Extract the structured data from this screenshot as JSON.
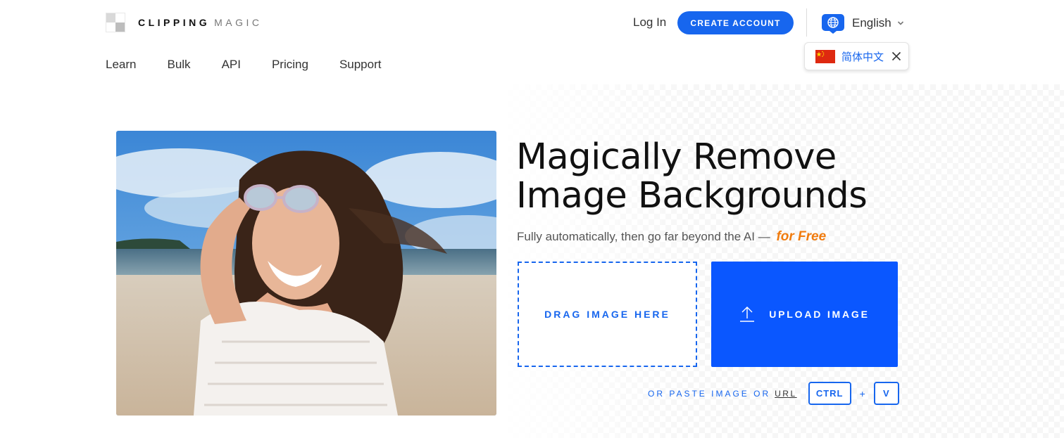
{
  "brand": {
    "name_bold": "CLIPPING",
    "name_light": "MAGIC"
  },
  "nav": {
    "items": [
      "Learn",
      "Bulk",
      "API",
      "Pricing",
      "Support"
    ]
  },
  "header": {
    "login_label": "Log In",
    "create_account_label": "CREATE ACCOUNT",
    "language_label": "English",
    "language_suggestion": "简体中文"
  },
  "hero": {
    "headline_line1": "Magically Remove",
    "headline_line2": "Image Backgrounds",
    "subline": "Fully automatically, then go far beyond the AI —",
    "subline_emphasis": "for Free",
    "drag_label": "DRAG IMAGE HERE",
    "upload_label": "UPLOAD IMAGE",
    "paste_text": "OR PASTE IMAGE OR",
    "paste_url": "URL",
    "key_ctrl": "CTRL",
    "key_plus": "+",
    "key_v": "V"
  },
  "colors": {
    "accent": "#1766ee",
    "upload": "#0a57ff",
    "free": "#f07b0e"
  },
  "icons": [
    "globe-icon",
    "chevron-down-icon",
    "china-flag-icon",
    "close-icon",
    "upload-icon"
  ]
}
